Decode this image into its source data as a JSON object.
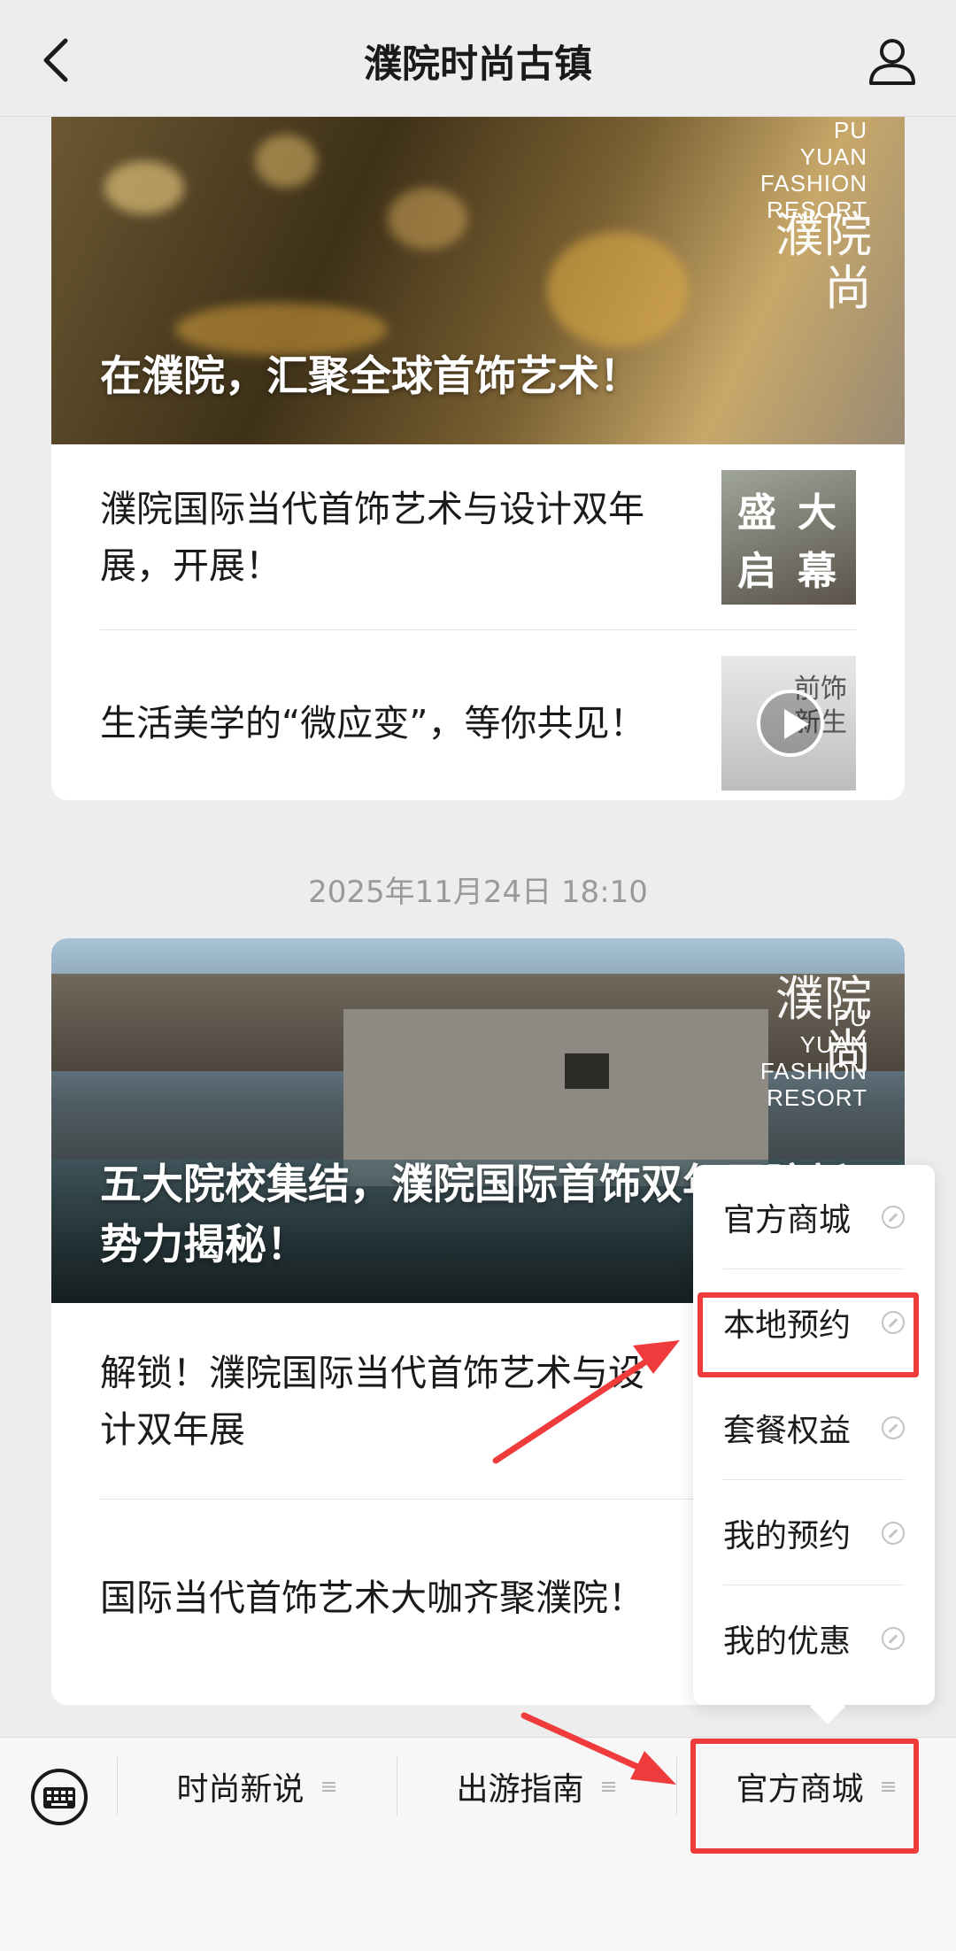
{
  "header": {
    "title": "濮院时尚古镇",
    "back_icon": "chevron-left-icon",
    "profile_icon": "person-icon"
  },
  "card1": {
    "cover_caption": "在濮院，汇聚全球首饰艺术！",
    "brand": {
      "latin": [
        "PU",
        "YUAN",
        "FASHION",
        "RESORT"
      ],
      "zh": "濮院尚"
    },
    "articles": [
      {
        "title": "濮院国际当代首饰艺术与设计双年展，开展！",
        "thumb_text": [
          "盛",
          "大",
          "启",
          "幕"
        ]
      },
      {
        "title": "生活美学的“微应变”，等你共见！",
        "thumb_text": [
          "前饰",
          "新生"
        ]
      }
    ]
  },
  "timestamp": "2025年11月24日 18:10",
  "card2": {
    "cover_caption": "五大院校集结，濮院国际首饰双年展院新势力揭秘！",
    "brand": {
      "latin": [
        "PU",
        "YUAN",
        "FASHION",
        "RESORT"
      ],
      "zh": "濮院尚"
    },
    "articles": [
      {
        "title": "解锁！濮院国际当代首饰艺术与设计双年展"
      },
      {
        "title": "国际当代首饰艺术大咖齐聚濮院！"
      }
    ]
  },
  "menu": {
    "keyboard_icon": "keyboard-icon",
    "items": [
      {
        "label": "时尚新说"
      },
      {
        "label": "出游指南"
      },
      {
        "label": "官方商城"
      }
    ]
  },
  "submenu": {
    "items": [
      {
        "label": "官方商城"
      },
      {
        "label": "本地预约"
      },
      {
        "label": "套餐权益"
      },
      {
        "label": "我的预约"
      },
      {
        "label": "我的优惠"
      }
    ]
  },
  "colors": {
    "background": "#ededed",
    "highlight": "#ef3b3b",
    "card": "#ffffff"
  }
}
